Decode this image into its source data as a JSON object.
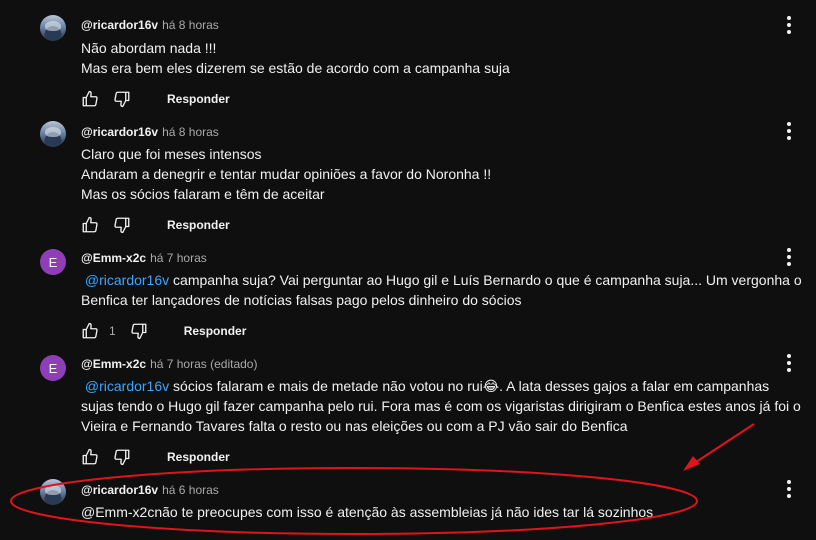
{
  "comments": [
    {
      "author": "@ricardor16v",
      "time": "há 8 horas",
      "lines": [
        "Não abordam nada !!!",
        "Mas era bem eles dizerem se estão de acordo com a campanha suja"
      ],
      "reply_label": "Responder"
    },
    {
      "author": "@ricardor16v",
      "time": "há 8 horas",
      "lines": [
        "Claro que foi meses intensos",
        "Andaram a denegrir e tentar mudar opiniões a favor do Noronha !!",
        "Mas os sócios falaram e têm de aceitar"
      ],
      "reply_label": "Responder"
    },
    {
      "author": "@Emm-x2c",
      "avatar_letter": "E",
      "time": "há 7 horas",
      "mention": "@ricardor16v",
      "line1_rest": " campanha suja? Vai perguntar ao Hugo gil e Luís Bernardo o que é campanha suja... Um vergonha o",
      "line2": "Benfica ter lançadores de notícias falsas pago pelos dinheiro do sócios",
      "like_count": "1",
      "reply_label": "Responder"
    },
    {
      "author": "@Emm-x2c",
      "avatar_letter": "E",
      "time": "há 7 horas (editado)",
      "mention": "@ricardor16v",
      "line1_rest": " sócios falaram e mais de metade não votou no rui😂. A lata desses gajos a falar em campanhas",
      "line2": "sujas tendo o Hugo gil fazer campanha pelo rui. Fora mas é com os vigaristas dirigiram o Benfica estes anos já foi o",
      "line3": "Vieira e Fernando Tavares falta o resto ou nas eleições ou com a PJ vão sair do Benfica",
      "reply_label": "Responder"
    },
    {
      "author": "@ricardor16v",
      "time": "há 6 horas",
      "lines": [
        "@Emm-x2cnão te preocupes com isso é atenção às assembleias já não ides tar lá sozinhos"
      ]
    }
  ],
  "colors": {
    "background": "#0f0f0f",
    "mention": "#3ea6ff",
    "annotation": "#e0141c",
    "avatar_letter_bg": "#8e3fb8"
  },
  "icons": [
    "thumb-up-icon",
    "thumb-down-icon",
    "more-vert-icon"
  ]
}
